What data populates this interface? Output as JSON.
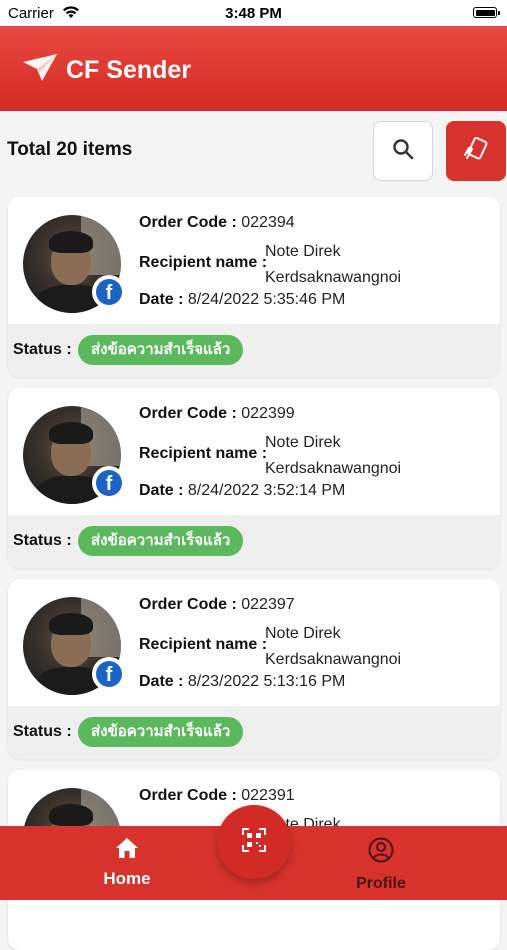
{
  "status_bar": {
    "carrier": "Carrier",
    "time": "3:48 PM"
  },
  "header": {
    "title": "CF Sender",
    "logo_icon": "paper-plane-icon",
    "color": "#e0342d"
  },
  "toolbar": {
    "total_label": "Total 20 items",
    "search_icon": "search-icon",
    "scan_icon": "card-scan-icon"
  },
  "labels": {
    "order_code": "Order Code :",
    "recipient_name": "Recipient name :",
    "date": "Date :",
    "status": "Status :"
  },
  "orders": [
    {
      "order_code": "022394",
      "recipient_first": "Note Direk",
      "recipient_last": "Kerdsaknawangnoi",
      "date": "8/24/2022 5:35:46 PM",
      "status": "ส่งข้อความสำเร็จแล้ว",
      "channel": "facebook"
    },
    {
      "order_code": "022399",
      "recipient_first": "Note Direk",
      "recipient_last": "Kerdsaknawangnoi",
      "date": "8/24/2022 3:52:14 PM",
      "status": "ส่งข้อความสำเร็จแล้ว",
      "channel": "facebook"
    },
    {
      "order_code": "022397",
      "recipient_first": "Note Direk",
      "recipient_last": "Kerdsaknawangnoi",
      "date": "8/23/2022 5:13:16 PM",
      "status": "ส่งข้อความสำเร็จแล้ว",
      "channel": "facebook"
    },
    {
      "order_code": "022391",
      "recipient_first": "Note Direk",
      "recipient_last": "",
      "date": "",
      "status": "",
      "channel": "facebook"
    }
  ],
  "bottom_nav": {
    "home_label": "Home",
    "profile_label": "Profile",
    "center_icon": "qr-code-icon",
    "status_color": "#5cb85c"
  }
}
